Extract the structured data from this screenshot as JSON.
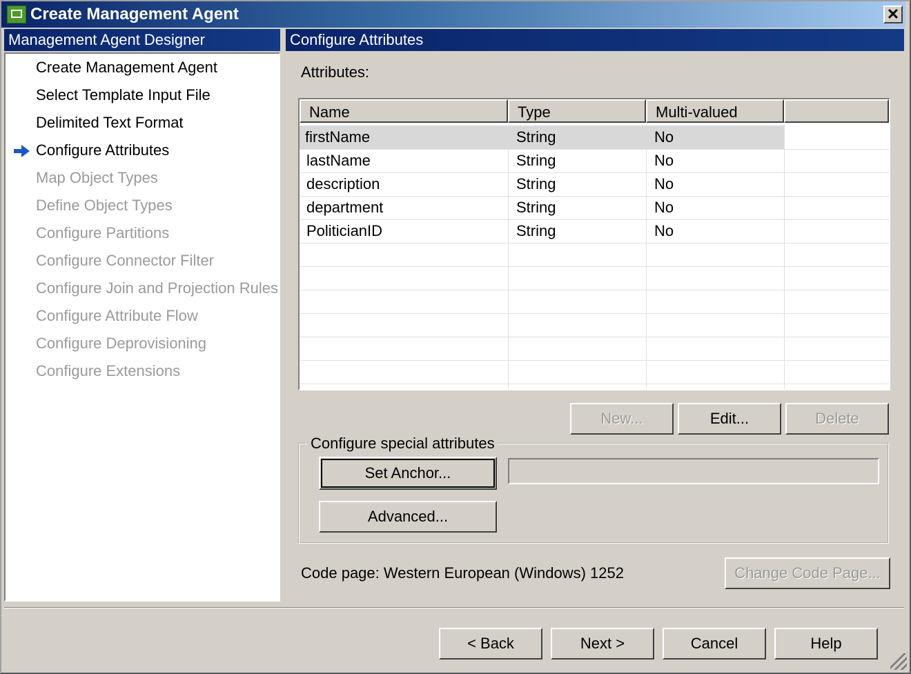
{
  "window": {
    "title": "Create Management Agent",
    "close_label": "✕"
  },
  "left_header": "Management Agent Designer",
  "right_header": "Configure Attributes",
  "nav": [
    {
      "label": "Create Management Agent",
      "state": "done"
    },
    {
      "label": "Select Template Input File",
      "state": "done"
    },
    {
      "label": "Delimited Text Format",
      "state": "done"
    },
    {
      "label": "Configure Attributes",
      "state": "current"
    },
    {
      "label": "Map Object Types",
      "state": "pending"
    },
    {
      "label": "Define Object Types",
      "state": "pending"
    },
    {
      "label": "Configure Partitions",
      "state": "pending"
    },
    {
      "label": "Configure Connector Filter",
      "state": "pending"
    },
    {
      "label": "Configure Join and Projection Rules",
      "state": "pending"
    },
    {
      "label": "Configure Attribute Flow",
      "state": "pending"
    },
    {
      "label": "Configure Deprovisioning",
      "state": "pending"
    },
    {
      "label": "Configure Extensions",
      "state": "pending"
    }
  ],
  "attributes": {
    "label": "Attributes:",
    "columns": [
      "Name",
      "Type",
      "Multi-valued"
    ],
    "rows": [
      [
        "firstName",
        "String",
        "No"
      ],
      [
        "lastName",
        "String",
        "No"
      ],
      [
        "description",
        "String",
        "No"
      ],
      [
        "department",
        "String",
        "No"
      ],
      [
        "PoliticianID",
        "String",
        "No"
      ]
    ]
  },
  "buttons": {
    "new": "New...",
    "edit": "Edit...",
    "delete": "Delete"
  },
  "special": {
    "title": "Configure special attributes",
    "set_anchor": "Set Anchor...",
    "advanced": "Advanced...",
    "anchor_value": ""
  },
  "code_page": {
    "text": "Code page: Western European (Windows) 1252",
    "change": "Change Code Page..."
  },
  "footer": {
    "back": "<  Back",
    "next": "Next  >",
    "cancel": "Cancel",
    "help": "Help"
  }
}
